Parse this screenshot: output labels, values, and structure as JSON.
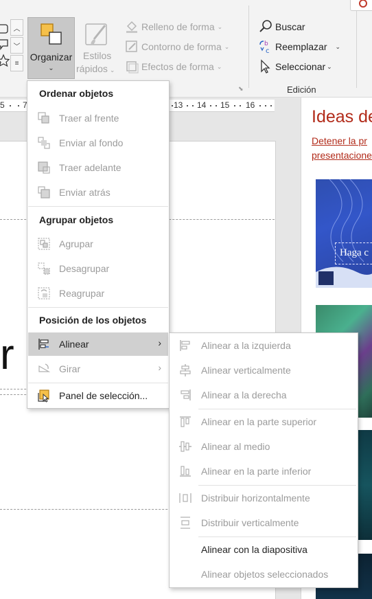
{
  "ribbon": {
    "organizar": "Organizar",
    "estilos_line1": "Estilos",
    "estilos_line2": "rápidos",
    "relleno": "Relleno de forma",
    "contorno": "Contorno de forma",
    "efectos": "Efectos de forma",
    "buscar": "Buscar",
    "reemplazar": "Reemplazar",
    "seleccionar": "Seleccionar",
    "edicion": "Edición"
  },
  "ruler": {
    "ticks": [
      "5",
      "7",
      "13",
      "14",
      "15",
      "16"
    ]
  },
  "slide": {
    "visible_char": "r"
  },
  "designer": {
    "title": "Ideas de",
    "link1": "Detener la pr",
    "link2": "presentacione",
    "thumb1_text": "Haga c"
  },
  "arrange_menu": {
    "header1": "Ordenar objetos",
    "traer_frente": "Traer al frente",
    "enviar_fondo": "Enviar al fondo",
    "traer_adelante": "Traer adelante",
    "enviar_atras": "Enviar atrás",
    "header2": "Agrupar objetos",
    "agrupar": "Agrupar",
    "desagrupar": "Desagrupar",
    "reagrupar": "Reagrupar",
    "header3": "Posición de los objetos",
    "alinear": "Alinear",
    "girar": "Girar",
    "panel": "Panel de selección..."
  },
  "align_menu": {
    "izquierda": "Alinear a la izquierda",
    "vertical": "Alinear verticalmente",
    "derecha": "Alinear a la derecha",
    "superior": "Alinear en la parte superior",
    "medio": "Alinear al medio",
    "inferior": "Alinear en la parte inferior",
    "dist_h": "Distribuir horizontalmente",
    "dist_v": "Distribuir verticalmente",
    "con_diapositiva": "Alinear con la diapositiva",
    "seleccionados": "Alinear objetos seleccionados"
  },
  "colors": {
    "accent_red": "#b22b1a",
    "hover_gray": "#d0d0d0",
    "disabled_text": "#9b9b9b"
  }
}
